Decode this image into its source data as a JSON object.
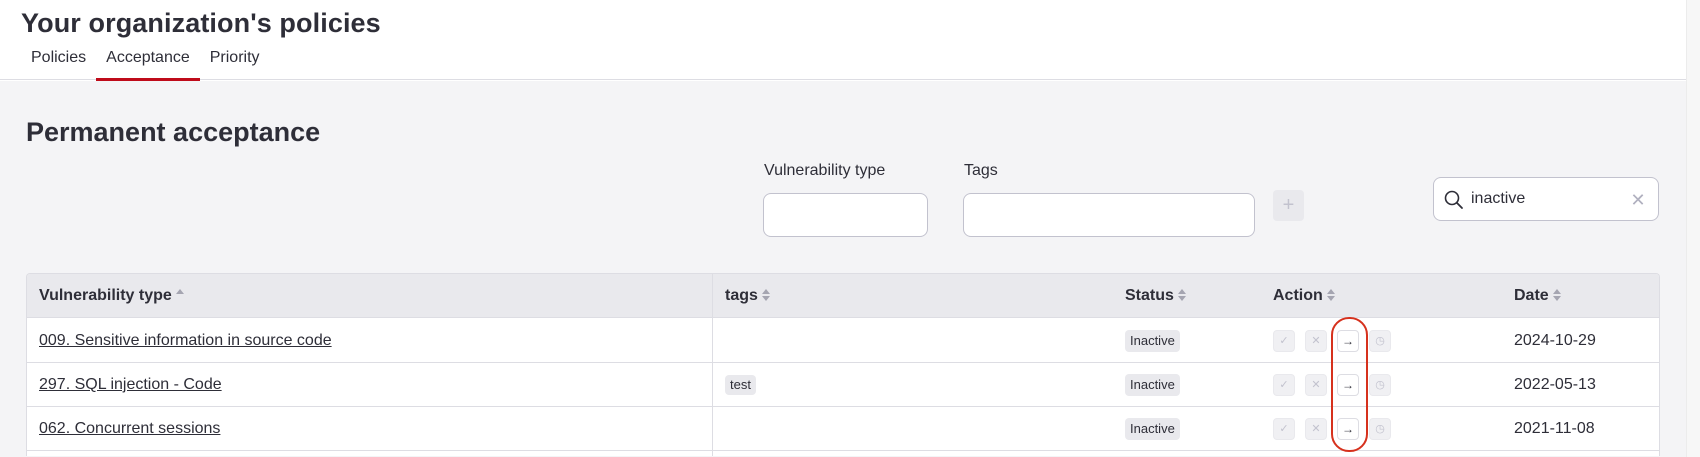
{
  "header": {
    "title": "Your organization's policies",
    "tabs": [
      {
        "label": "Policies",
        "active": false
      },
      {
        "label": "Acceptance",
        "active": true
      },
      {
        "label": "Priority",
        "active": false
      }
    ]
  },
  "section": {
    "title": "Permanent acceptance"
  },
  "filters": {
    "vulnerability_type_label": "Vulnerability type",
    "vulnerability_type_value": "",
    "tags_label": "Tags",
    "tags_value": "",
    "add_label": "+"
  },
  "search": {
    "value": "inactive",
    "icon": "search-icon",
    "clear_icon": "close-icon"
  },
  "table": {
    "columns": [
      {
        "label": "Vulnerability type",
        "sort": "asc"
      },
      {
        "label": "tags",
        "sort": "none"
      },
      {
        "label": "Status",
        "sort": "none"
      },
      {
        "label": "Action",
        "sort": "none"
      },
      {
        "label": "Date",
        "sort": "none"
      }
    ],
    "rows": [
      {
        "vulnerability": "009. Sensitive information in source code",
        "tag": "",
        "status": "Inactive",
        "date": "2024-10-29"
      },
      {
        "vulnerability": "297. SQL injection - Code",
        "tag": "test",
        "status": "Inactive",
        "date": "2022-05-13"
      },
      {
        "vulnerability": "062. Concurrent sessions",
        "tag": "",
        "status": "Inactive",
        "date": "2021-11-08"
      }
    ],
    "action_icons": [
      "check-icon",
      "close-icon",
      "arrow-right-icon",
      "clock-icon"
    ],
    "action_glyphs": {
      "check": "✓",
      "close": "✕",
      "arrow": "→",
      "clock": "◷"
    }
  },
  "colors": {
    "accent": "#bf0b1a",
    "highlight": "#d6311d",
    "text": "#2e2e38",
    "table_header_bg": "#e9e9ed",
    "page_bg": "#f4f4f6"
  }
}
